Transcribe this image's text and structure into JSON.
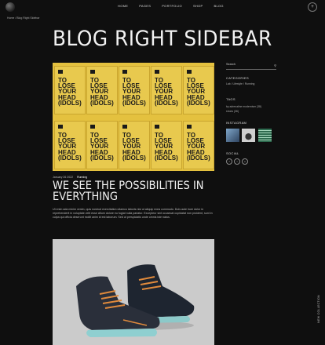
{
  "nav": {
    "items": [
      "HOME",
      "PAGES",
      "PORTFOLIO",
      "SHOP",
      "BLOG"
    ],
    "menu_icon": "plus-icon"
  },
  "breadcrumb": {
    "home": "Home",
    "separator": "/",
    "current": "Blog Right Sidebar"
  },
  "page_title": "BLOG RIGHT SIDEBAR",
  "post": {
    "date": "January 26 2022",
    "category": "Running",
    "title": "WE SEE THE POSSIBILITIES IN EVERYTHING",
    "excerpt": "Ut enim ada minim venim, quis nostrud exercitation ullamco laboris nisi ut aliquip exea commodo. Duis aute irure dolor in reprehenderit in voluptate velit esse cillum dolore eu fugiat nulla pariatur. Excepteur sint occaecat cupidatat non proident, sunt in culpa qui officia deserunt mollit anim id est laborum. Sed ut perspiciatis unde omnis iste natus.",
    "poster_text": "TO LOSE YOUR HEAD (IDOLS)"
  },
  "sidebar": {
    "search_placeholder": "Search",
    "categories_heading": "CATEGORIES",
    "categories": "Lab / Lifestyle / Running",
    "tags_heading": "TAGS",
    "tags_line1": "by adrenaline   modernism   (38)",
    "tags_line2": "shoes (36)",
    "instagram_heading": "INSTAGRAM",
    "social_heading": "SOCIAL",
    "social_icons": [
      "fb",
      "tw",
      "in"
    ]
  },
  "vertical_text": "NEW COLLECTION"
}
